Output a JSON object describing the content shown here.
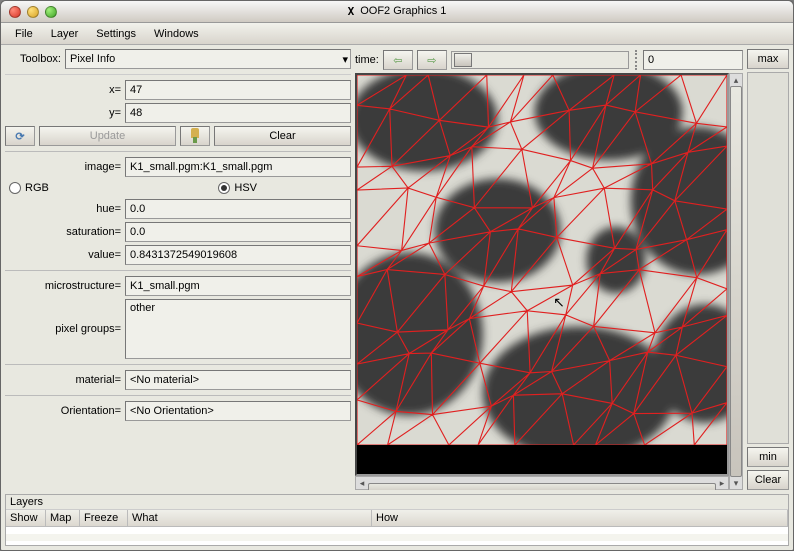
{
  "window": {
    "title": "OOF2 Graphics 1"
  },
  "menu": [
    "File",
    "Layer",
    "Settings",
    "Windows"
  ],
  "toolbox": {
    "label": "Toolbox:",
    "value": "Pixel Info"
  },
  "time": {
    "label": "time:",
    "value": "0",
    "max_button": "max",
    "min_button": "min",
    "clear_button": "Clear"
  },
  "pixel": {
    "x_label": "x=",
    "x": "47",
    "y_label": "y=",
    "y": "48",
    "update": "Update",
    "clear": "Clear",
    "image_label": "image=",
    "image": "K1_small.pgm:K1_small.pgm",
    "rgb": "RGB",
    "hsv": "HSV",
    "hue_label": "hue=",
    "hue": "0.0",
    "sat_label": "saturation=",
    "sat": "0.0",
    "val_label": "value=",
    "val": "0.8431372549019608",
    "micro_label": "microstructure=",
    "micro": "K1_small.pgm",
    "pg_label": "pixel groups=",
    "pg": "other",
    "mat_label": "material=",
    "mat": "<No material>",
    "or_label": "Orientation=",
    "or": "<No Orientation>"
  },
  "layers": {
    "title": "Layers",
    "cols": [
      "Show",
      "Map",
      "Freeze",
      "What",
      "How"
    ]
  }
}
